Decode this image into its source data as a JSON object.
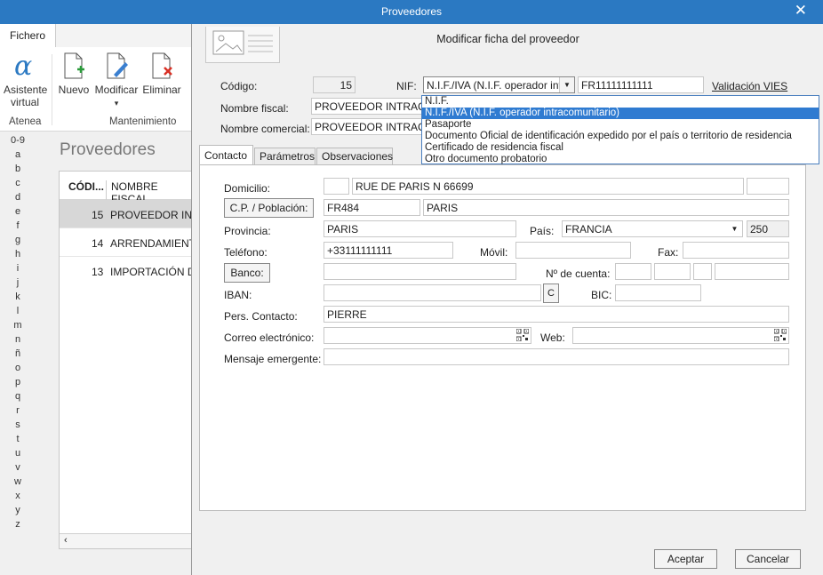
{
  "window": {
    "title": "Proveedores"
  },
  "menu": {
    "fichero": "Fichero"
  },
  "ribbon": {
    "asistente_line1": "Asistente",
    "asistente_line2": "virtual",
    "nuevo": "Nuevo",
    "modificar": "Modificar",
    "modificar_arrow": "▾",
    "eliminar": "Eliminar",
    "group_atenea": "Atenea",
    "group_mantenimiento": "Mantenimiento"
  },
  "alphabet": [
    "0-9",
    "a",
    "b",
    "c",
    "d",
    "e",
    "f",
    "g",
    "h",
    "i",
    "j",
    "k",
    "l",
    "m",
    "n",
    "ñ",
    "o",
    "p",
    "q",
    "r",
    "s",
    "t",
    "u",
    "v",
    "w",
    "x",
    "y",
    "z"
  ],
  "list": {
    "title": "Proveedores",
    "columns": [
      "CÓDI...",
      "NOMBRE FISCAL"
    ],
    "rows": [
      {
        "code": "15",
        "name": "PROVEEDOR INTRACOMUNITARIO"
      },
      {
        "code": "14",
        "name": "ARRENDAMIENTO"
      },
      {
        "code": "13",
        "name": "IMPORTACIÓN D"
      }
    ]
  },
  "dialog": {
    "title": "Modificar ficha del proveedor",
    "codigo_label": "Código:",
    "codigo_value": "15",
    "nif_label": "NIF:",
    "nif_type": "N.I.F./IVA (N.I.F. operador int",
    "nif_value": "FR11111111111",
    "vies_link": "Validación VIES",
    "nombre_fiscal_label": "Nombre fiscal:",
    "nombre_fiscal_value": "PROVEEDOR INTRACOMUNITARIO",
    "nombre_comercial_label": "Nombre comercial:",
    "nombre_comercial_value": "PROVEEDOR INTRACOMUNITARIO",
    "nif_options": [
      "N.I.F.",
      "N.I.F./IVA (N.I.F. operador intracomunitario)",
      "Pasaporte",
      "Documento Oficial de identificación expedido por el país o territorio de residencia",
      "Certificado de residencia fiscal",
      "Otro documento probatorio"
    ],
    "tabs": [
      "Contacto",
      "Parámetros",
      "Observaciones"
    ],
    "domicilio_label": "Domicilio:",
    "domicilio_value": "RUE DE PARIS N 66699",
    "cp_button": "C.P. / Población:",
    "cp_value": "FR484",
    "poblacion_value": "PARIS",
    "provincia_label": "Provincia:",
    "provincia_value": "PARIS",
    "pais_label": "País:",
    "pais_value": "FRANCIA",
    "pais_code": "250",
    "telefono_label": "Teléfono:",
    "telefono_value": "+33111111111",
    "movil_label": "Móvil:",
    "fax_label": "Fax:",
    "banco_button": "Banco:",
    "cuenta_label": "Nº de cuenta:",
    "iban_label": "IBAN:",
    "iban_c_button": "C",
    "bic_label": "BIC:",
    "contacto_label": "Pers. Contacto:",
    "contacto_value": "PIERRE",
    "correo_label": "Correo electrónico:",
    "web_label": "Web:",
    "mensaje_label": "Mensaje emergente:",
    "aceptar": "Aceptar",
    "cancelar": "Cancelar"
  },
  "colors": {
    "titlebar": "#2b79c2",
    "highlight": "#2f7bd1"
  }
}
